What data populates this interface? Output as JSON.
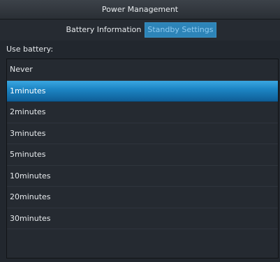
{
  "window": {
    "title": "Power Management"
  },
  "tabs": [
    {
      "label": "Battery Information",
      "active": false
    },
    {
      "label": "Standby Settings",
      "active": true
    }
  ],
  "section": {
    "label": "Use battery:"
  },
  "options": {
    "items": [
      {
        "label": "Never",
        "selected": false
      },
      {
        "label": "1minutes",
        "selected": true
      },
      {
        "label": "2minutes",
        "selected": false
      },
      {
        "label": "3minutes",
        "selected": false
      },
      {
        "label": "5minutes",
        "selected": false
      },
      {
        "label": "10minutes",
        "selected": false
      },
      {
        "label": "20minutes",
        "selected": false
      },
      {
        "label": "30minutes",
        "selected": false
      }
    ]
  },
  "colors": {
    "accent": "#2d84b8",
    "selection": "#1d86c5",
    "background": "#22272e"
  }
}
